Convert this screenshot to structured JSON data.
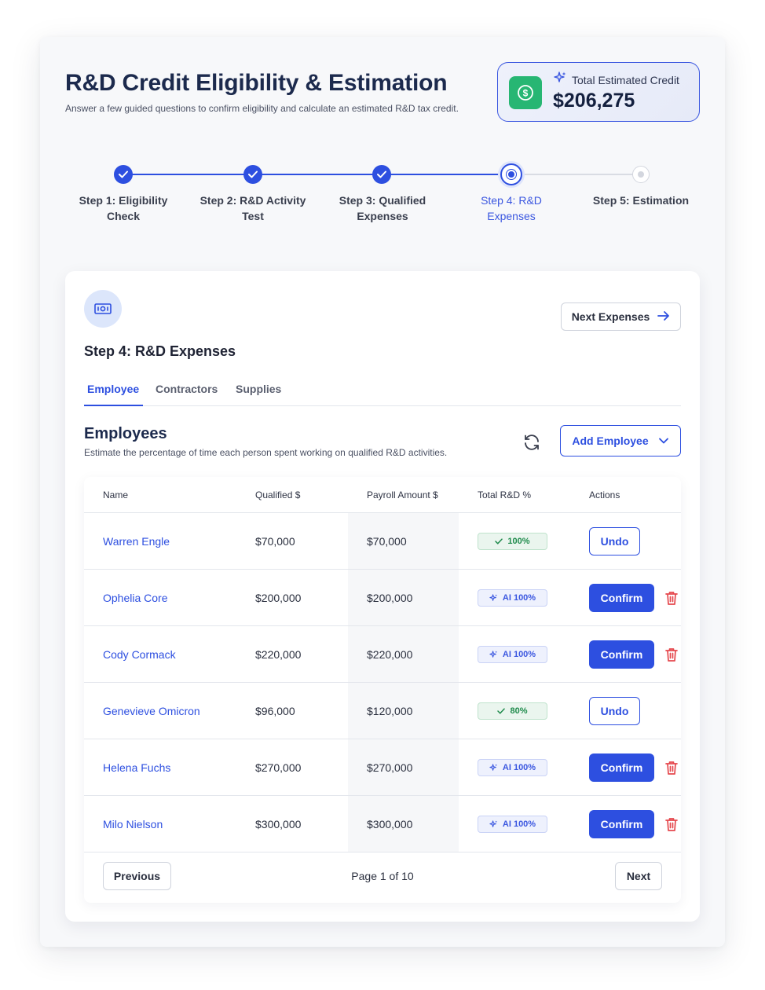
{
  "header": {
    "title": "R&D Credit Eligibility & Estimation",
    "subtitle": "Answer a few guided questions to confirm eligibility and calculate an estimated R&D tax credit.",
    "credit_label": "Total Estimated Credit",
    "credit_value": "$206,275",
    "credit_icon": "dollar-circle-icon",
    "sparkle_icon": "sparkle-icon"
  },
  "stepper": {
    "steps": [
      {
        "label_1": "Step 1: Eligibility",
        "label_2": "Check",
        "state": "done"
      },
      {
        "label_1": "Step 2: R&D Activity",
        "label_2": "Test",
        "state": "done"
      },
      {
        "label_1": "Step 3: Qualified",
        "label_2": "Expenses",
        "state": "done"
      },
      {
        "label_1": "Step 4: R&D",
        "label_2": "Expenses",
        "state": "current"
      },
      {
        "label_1": "Step 5: Estimation",
        "label_2": "",
        "state": "todo"
      }
    ]
  },
  "card": {
    "title": "Step 4: R&D Expenses",
    "next_button": "Next Expenses",
    "tabs": [
      "Employee",
      "Contractors",
      "Supplies"
    ],
    "active_tab": "Employee"
  },
  "section": {
    "title": "Employees",
    "subtitle": "Estimate the percentage of time each person spent working on qualified R&D activities.",
    "add_button": "Add Employee"
  },
  "table": {
    "columns": [
      "Name",
      "Qualified $",
      "Payroll Amount $",
      "Total R&D %",
      "Actions"
    ],
    "rows": [
      {
        "name": "Warren Engle",
        "qualified": "$70,000",
        "payroll": "$70,000",
        "badge": "100%",
        "badge_type": "ok",
        "action": "Undo"
      },
      {
        "name": "Ophelia Core",
        "qualified": "$200,000",
        "payroll": "$200,000",
        "badge": "AI 100%",
        "badge_type": "ai",
        "action": "Confirm"
      },
      {
        "name": "Cody Cormack",
        "qualified": "$220,000",
        "payroll": "$220,000",
        "badge": "AI 100%",
        "badge_type": "ai",
        "action": "Confirm"
      },
      {
        "name": "Genevieve Omicron",
        "qualified": "$96,000",
        "payroll": "$120,000",
        "badge": "80%",
        "badge_type": "ok",
        "action": "Undo"
      },
      {
        "name": "Helena Fuchs",
        "qualified": "$270,000",
        "payroll": "$270,000",
        "badge": "AI 100%",
        "badge_type": "ai",
        "action": "Confirm"
      },
      {
        "name": "Milo Nielson",
        "qualified": "$300,000",
        "payroll": "$300,000",
        "badge": "AI 100%",
        "badge_type": "ai",
        "action": "Confirm"
      }
    ]
  },
  "pagination": {
    "previous": "Previous",
    "info": "Page 1 of 10",
    "next": "Next"
  },
  "colors": {
    "primary": "#2d4fe0",
    "success": "#27b673",
    "danger": "#e5484d"
  }
}
